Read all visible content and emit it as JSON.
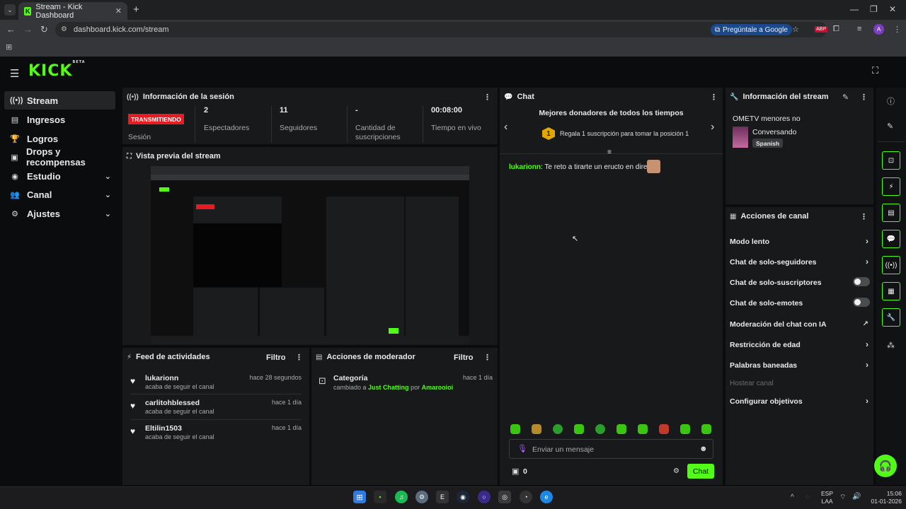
{
  "browser": {
    "tab_title": "Stream - Kick Dashboard",
    "favicon_letter": "K",
    "url": "dashboard.kick.com/stream",
    "google_button": "Pregúntale a Google",
    "profile_initial": "A",
    "abp_label": "ABP"
  },
  "app": {
    "logo": "KICK",
    "logo_badge": "BETA"
  },
  "nav": [
    {
      "label": "Stream",
      "icon": "broadcast-icon",
      "active": true
    },
    {
      "label": "Ingresos",
      "icon": "wallet-icon"
    },
    {
      "label": "Logros",
      "icon": "trophy-icon"
    },
    {
      "label": "Drops y recompensas",
      "icon": "gift-icon"
    },
    {
      "label": "Estudio",
      "icon": "studio-icon",
      "expandable": true
    },
    {
      "label": "Canal",
      "icon": "users-icon",
      "expandable": true
    },
    {
      "label": "Ajustes",
      "icon": "gear-icon",
      "expandable": true
    }
  ],
  "session": {
    "title": "Información de la sesión",
    "live_badge": "TRANSMITIENDO",
    "session_label": "Sesión",
    "stats": [
      {
        "value": "2",
        "label": "Espectadores"
      },
      {
        "value": "11",
        "label": "Seguidores"
      },
      {
        "value": "-",
        "label": "Cantidad de suscripciones"
      },
      {
        "value": "00:08:00",
        "label": "Tiempo en vivo"
      }
    ]
  },
  "preview": {
    "title": "Vista previa del stream"
  },
  "feed": {
    "title": "Feed de actividades",
    "filter": "Filtro",
    "items": [
      {
        "name": "lukarionn",
        "time": "hace 28 segundos",
        "desc": "acaba de seguir el canal"
      },
      {
        "name": "carlitohblessed",
        "time": "hace 1 día",
        "desc": "acaba de seguir el canal"
      },
      {
        "name": "Eltilin1503",
        "time": "hace 1 día",
        "desc": "acaba de seguir el canal"
      }
    ]
  },
  "moderator": {
    "title": "Acciones de moderador",
    "filter": "Filtro",
    "item": {
      "title": "Categoría",
      "time": "hace 1 día",
      "prefix": "cambiado a",
      "category": "Just Chatting",
      "by": "por",
      "user": "Amarooioi"
    }
  },
  "chat": {
    "title": "Chat",
    "donors_title": "Mejores donadores de todos los tiempos",
    "donors_rank": "1",
    "donors_text": "Regala 1 suscripción para tomar la posición 1",
    "message_user": "lukarionn",
    "message_text": ": Te reto a tirarte un eructo en directo",
    "input_placeholder": "Enviar un mensaje",
    "points": "0",
    "send_button": "Chat",
    "accent": "#53fc18"
  },
  "stream_info": {
    "title": "Información del stream",
    "stream_title": "OMETV menores no",
    "category": "Conversando",
    "language": "Spanish"
  },
  "channel_actions": {
    "title": "Acciones de canal",
    "items": [
      {
        "label": "Modo lento",
        "control": "chevron"
      },
      {
        "label": "Chat de solo-seguidores",
        "control": "chevron"
      },
      {
        "label": "Chat de solo-suscriptores",
        "control": "toggle"
      },
      {
        "label": "Chat de solo-emotes",
        "control": "toggle"
      },
      {
        "label": "Moderación del chat con IA",
        "control": "external"
      },
      {
        "label": "Restricción de edad",
        "control": "chevron"
      },
      {
        "label": "Palabras baneadas",
        "control": "chevron"
      },
      {
        "label": "Hostear canal",
        "control": "disabled"
      },
      {
        "label": "Configurar objetivos",
        "control": "chevron"
      }
    ]
  },
  "taskbar": {
    "lang_top": "ESP",
    "lang_bottom": "LAA",
    "time": "15:06",
    "date": "01-01-2026"
  }
}
